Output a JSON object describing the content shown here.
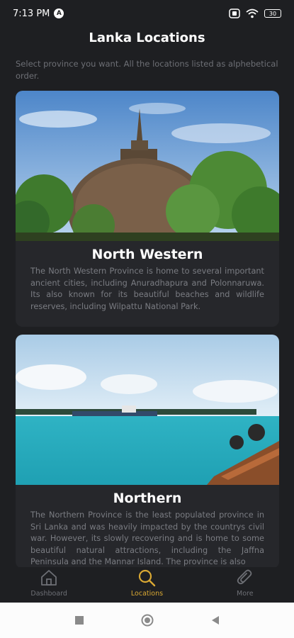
{
  "status": {
    "time": "7:13 PM",
    "notif_badge": "A",
    "battery": "30"
  },
  "header": {
    "title": "Lanka Locations",
    "subtitle": "Select province you want. All the locations listed as alphebetical order."
  },
  "cards": [
    {
      "name": "North Western",
      "description": "The North Western Province is home to several important ancient cities, including Anuradhapura and Polonnaruwa. Its also known for its beautiful beaches and wildlife reserves, including Wilpattu National Park."
    },
    {
      "name": "Northern",
      "description": "The Northern Province is the least populated province in Sri Lanka and was heavily impacted by the countrys civil war. However, its slowly recovering and is home to some beautiful natural attractions, including the Jaffna Peninsula and the Mannar Island. The province is also"
    }
  ],
  "nav": {
    "items": [
      {
        "label": "Dashboard",
        "icon": "home-icon"
      },
      {
        "label": "Locations",
        "icon": "search-icon",
        "active": true
      },
      {
        "label": "More",
        "icon": "paperclip-icon"
      }
    ]
  },
  "colors": {
    "background": "#1e1f22",
    "card": "#26272b",
    "accent": "#d9a833",
    "muted": "#6d6f75"
  }
}
